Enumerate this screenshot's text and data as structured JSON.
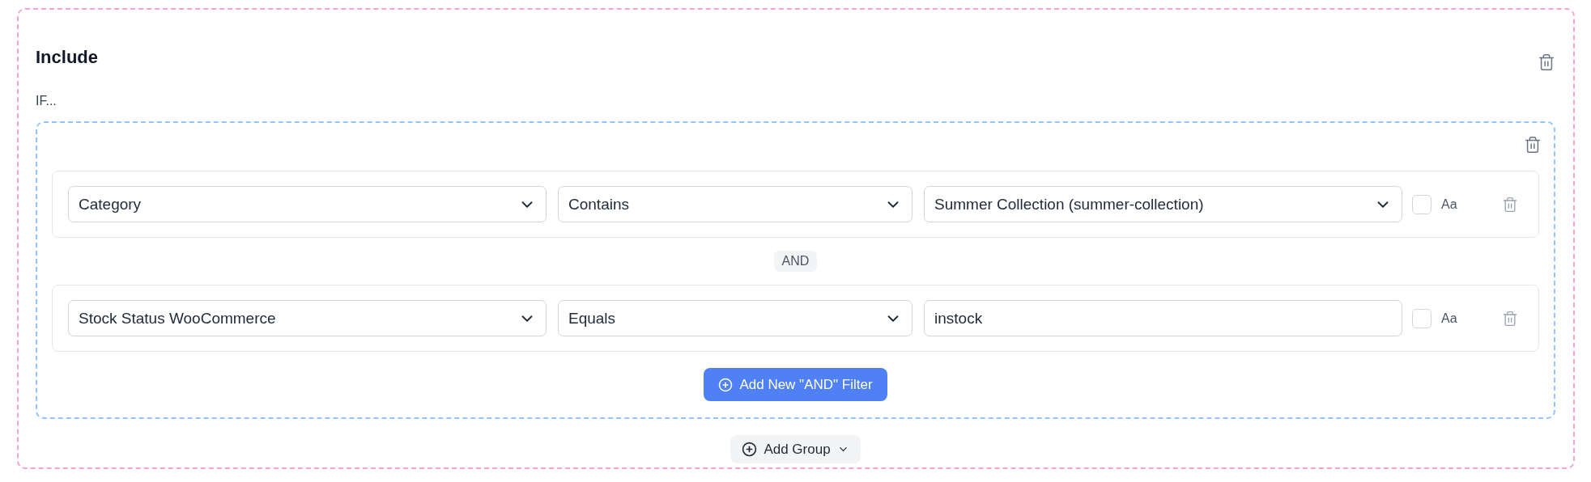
{
  "rule": {
    "title": "Include",
    "condition_label": "IF...",
    "group": {
      "filters": [
        {
          "field": "Category",
          "operator": "Contains",
          "value": {
            "kind": "select",
            "text": "Summer Collection (summer-collection)"
          },
          "case_checked": false,
          "case_label": "Aa"
        },
        {
          "field": "Stock Status WooCommerce",
          "operator": "Equals",
          "value": {
            "kind": "text",
            "text": "instock"
          },
          "case_checked": false,
          "case_label": "Aa"
        }
      ],
      "joiner": "AND",
      "add_filter_button": "Add New \"AND\" Filter"
    },
    "add_group_button": "Add Group"
  }
}
